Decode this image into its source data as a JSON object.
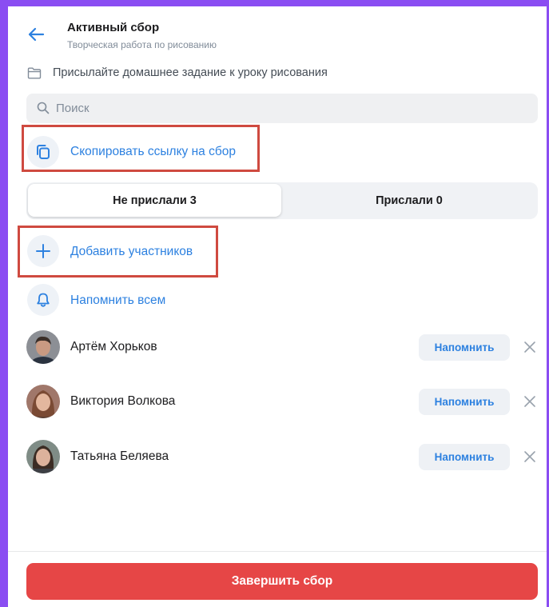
{
  "header": {
    "title": "Активный сбор",
    "subtitle": "Творческая работа по рисованию"
  },
  "description": "Присылайте домашнее задание к уроку рисования",
  "search": {
    "placeholder": "Поиск"
  },
  "copy_link": {
    "label": "Скопировать ссылку на сбор",
    "icon": "copy-icon"
  },
  "tabs": [
    {
      "label": "Не прислали 3",
      "active": true
    },
    {
      "label": "Прислали 0",
      "active": false
    }
  ],
  "actions": {
    "add_participants": "Добавить участников",
    "remind_all": "Напомнить всем"
  },
  "participants": [
    {
      "name": "Артём Хорьков",
      "remind_label": "Напомнить"
    },
    {
      "name": "Виктория Волкова",
      "remind_label": "Напомнить"
    },
    {
      "name": "Татьяна Беляева",
      "remind_label": "Напомнить"
    }
  ],
  "footer": {
    "finish_label": "Завершить сбор"
  },
  "colors": {
    "accent": "#2d81e0",
    "danger": "#e64646",
    "frame": "#8a4df2",
    "highlight": "#cf4a40"
  }
}
